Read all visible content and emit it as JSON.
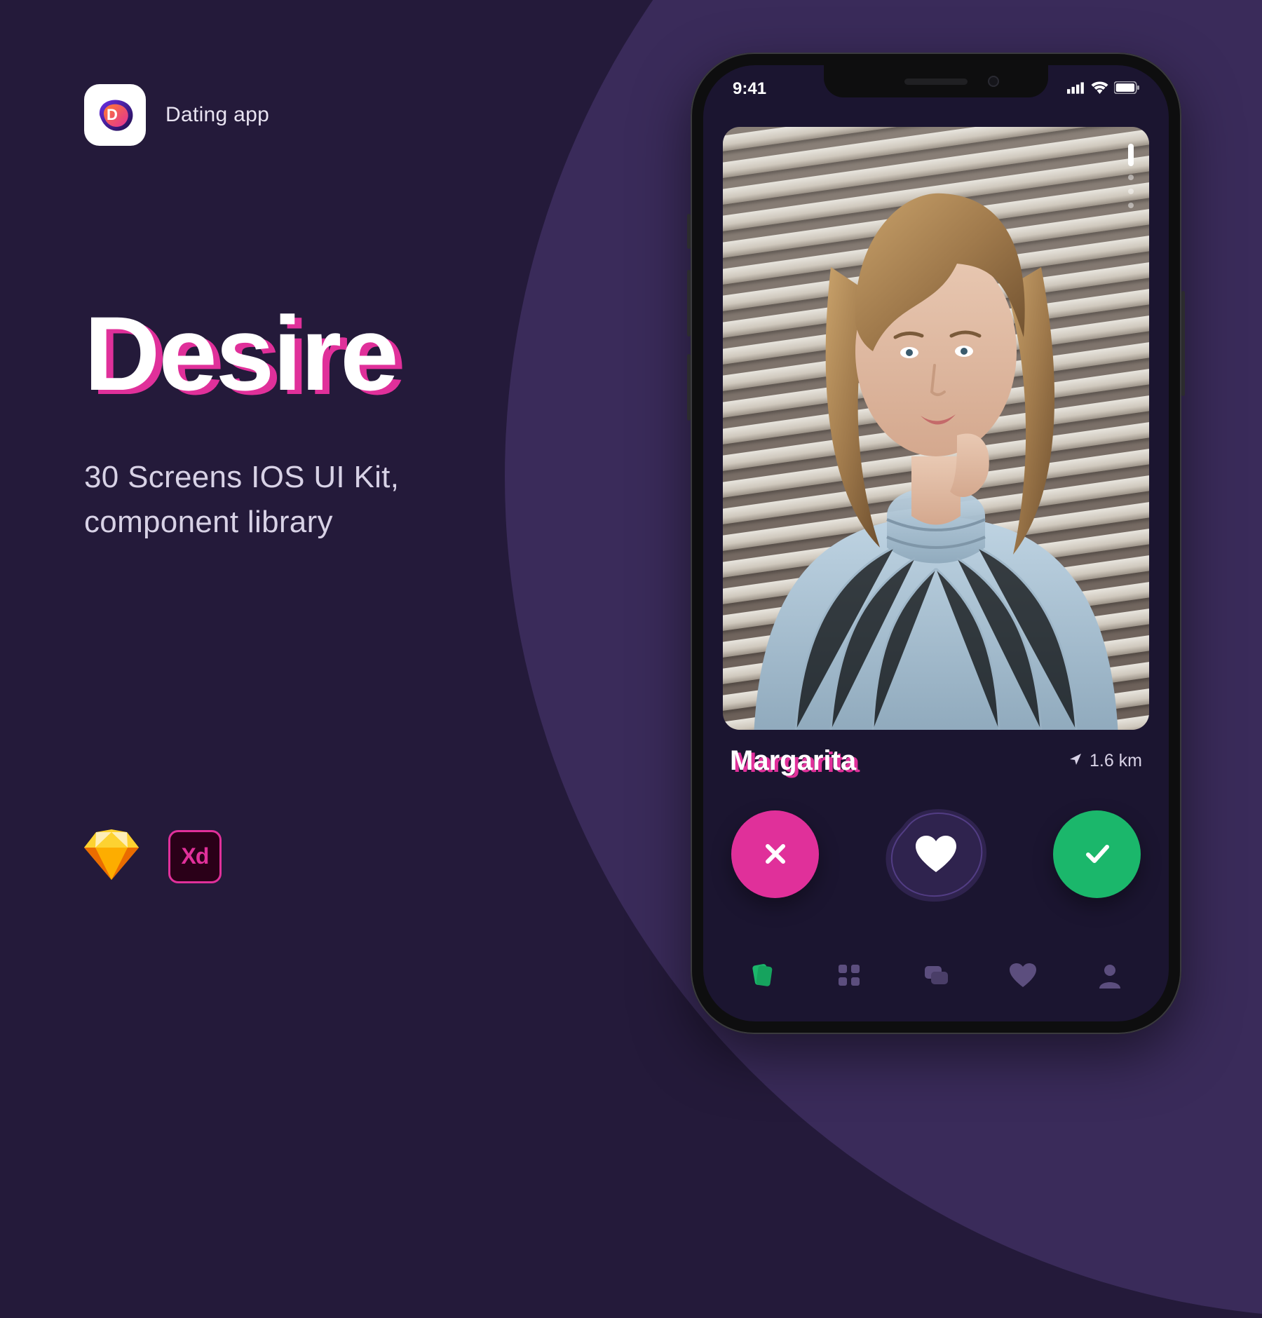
{
  "app": {
    "label": "Dating app",
    "icon_letter": "D"
  },
  "hero": {
    "title": "Desire",
    "subtitle_line1": "30 Screens IOS UI Kit,",
    "subtitle_line2": "component library"
  },
  "tools": {
    "sketch": "sketch-icon",
    "xd_label": "Xd"
  },
  "phone": {
    "status": {
      "time": "9:41"
    },
    "profile": {
      "name": "Margarita",
      "distance": "1.6 km"
    },
    "actions": {
      "reject": "reject",
      "super": "super-like",
      "accept": "accept"
    },
    "tabs": [
      "cards",
      "grid",
      "chat",
      "likes",
      "profile"
    ]
  },
  "colors": {
    "accent": "#E0309A",
    "success": "#1BB76B",
    "bg": "#241A3A",
    "bg2": "#3A2B5A",
    "phone_bg": "#1B1530"
  }
}
